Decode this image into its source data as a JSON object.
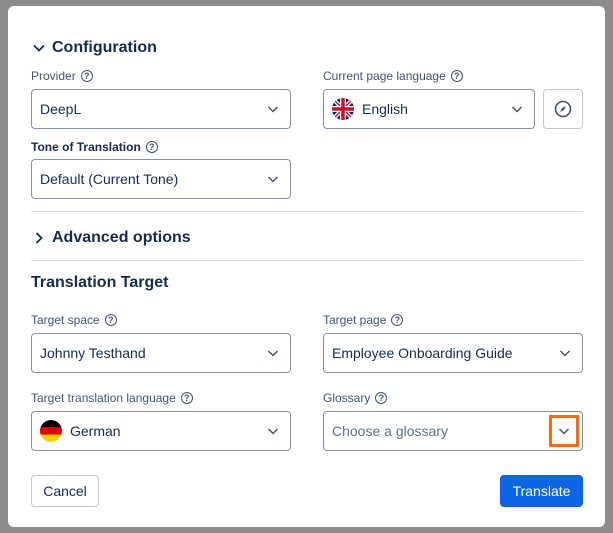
{
  "configuration": {
    "title": "Configuration",
    "provider": {
      "label": "Provider",
      "value": "DeepL"
    },
    "current_language": {
      "label": "Current page language",
      "value": "English"
    },
    "tone": {
      "label": "Tone of Translation",
      "value": "Default (Current Tone)"
    }
  },
  "advanced": {
    "title": "Advanced options"
  },
  "target": {
    "title": "Translation Target",
    "space": {
      "label": "Target space",
      "value": "Johnny Testhand"
    },
    "page": {
      "label": "Target page",
      "value": "Employee Onboarding Guide"
    },
    "language": {
      "label": "Target translation language",
      "value": "German"
    },
    "glossary": {
      "label": "Glossary",
      "placeholder": "Choose a glossary"
    }
  },
  "footer": {
    "cancel_label": "Cancel",
    "translate_label": "Translate"
  },
  "colors": {
    "primary": "#0c66e4",
    "highlight": "#f26a1b"
  },
  "icons": {
    "help": "help-icon",
    "caret": "chevron-down-icon",
    "compass": "compass-icon"
  }
}
